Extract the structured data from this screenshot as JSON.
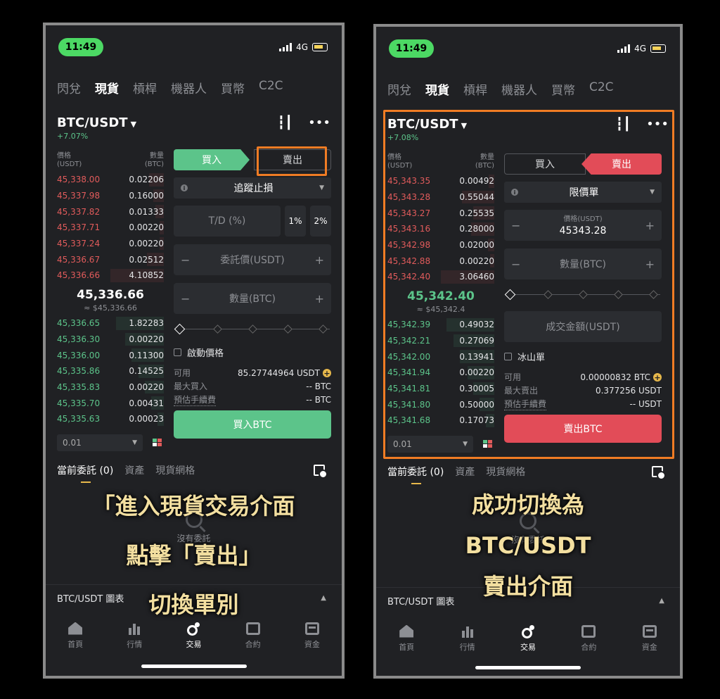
{
  "left": {
    "status": {
      "time": "11:49",
      "network": "4G"
    },
    "top_tabs": [
      "閃兌",
      "現貨",
      "槓桿",
      "機器人",
      "買幣",
      "C2C"
    ],
    "pair": {
      "name": "BTC/USDT",
      "change": "+7.07%"
    },
    "book": {
      "price_header": "價格",
      "price_unit": "(USDT)",
      "qty_header": "數量",
      "qty_unit": "(BTC)",
      "asks": [
        {
          "price": "45,338.00",
          "qty": "0.02206",
          "depth": 0.14
        },
        {
          "price": "45,337.98",
          "qty": "0.16000",
          "depth": 0.1
        },
        {
          "price": "45,337.82",
          "qty": "0.01333",
          "depth": 0.08
        },
        {
          "price": "45,337.71",
          "qty": "0.00220",
          "depth": 0.04
        },
        {
          "price": "45,337.24",
          "qty": "0.00220",
          "depth": 0.04
        },
        {
          "price": "45,336.67",
          "qty": "0.02512",
          "depth": 0.16
        },
        {
          "price": "45,336.66",
          "qty": "4.10852",
          "depth": 0.5
        }
      ],
      "mid_price": "45,336.66",
      "mid_sub": "≈ $45,336.66",
      "bids": [
        {
          "price": "45,336.65",
          "qty": "1.82283",
          "depth": 0.45
        },
        {
          "price": "45,336.30",
          "qty": "0.00220",
          "depth": 0.36
        },
        {
          "price": "45,336.00",
          "qty": "0.11300",
          "depth": 0.3
        },
        {
          "price": "45,335.86",
          "qty": "0.14525",
          "depth": 0.24
        },
        {
          "price": "45,335.83",
          "qty": "0.00220",
          "depth": 0.18
        },
        {
          "price": "45,335.70",
          "qty": "0.00431",
          "depth": 0.12
        },
        {
          "price": "45,335.63",
          "qty": "0.00023",
          "depth": 0.06
        }
      ],
      "depth_value": "0.01"
    },
    "form": {
      "buy_label": "買入",
      "sell_label": "賣出",
      "order_type": "追蹤止損",
      "td_placeholder": "T/D (%)",
      "pct1": "1%",
      "pct2": "2%",
      "price_placeholder": "委託價(USDT)",
      "amount_placeholder": "數量(BTC)",
      "check_label": "啟動價格",
      "available_label": "可用",
      "available_value": "85.27744964 USDT",
      "max_label": "最大買入",
      "max_value": "-- BTC",
      "fee_label": "預估手續費",
      "fee_value": "-- BTC",
      "submit_label": "買入BTC"
    },
    "bottom_tabs": [
      "當前委託 (0)",
      "資產",
      "現貨網格"
    ],
    "empty_text": "沒有委託",
    "chart_label": "BTC/USDT 圖表",
    "nav": [
      "首頁",
      "行情",
      "交易",
      "合約",
      "資金"
    ],
    "caption": [
      "「進入現貨交易介面",
      "點擊「賣出」",
      "切換單別"
    ]
  },
  "right": {
    "status": {
      "time": "11:49",
      "network": "4G"
    },
    "top_tabs": [
      "閃兌",
      "現貨",
      "槓桿",
      "機器人",
      "買幣",
      "C2C"
    ],
    "pair": {
      "name": "BTC/USDT",
      "change": "+7.08%"
    },
    "book": {
      "price_header": "價格",
      "price_unit": "(USDT)",
      "qty_header": "數量",
      "qty_unit": "(BTC)",
      "asks": [
        {
          "price": "45,343.35",
          "qty": "0.00492",
          "depth": 0.05
        },
        {
          "price": "45,343.28",
          "qty": "0.55044",
          "depth": 0.3
        },
        {
          "price": "45,343.27",
          "qty": "0.25535",
          "depth": 0.2
        },
        {
          "price": "45,343.16",
          "qty": "0.28000",
          "depth": 0.22
        },
        {
          "price": "45,342.98",
          "qty": "0.02000",
          "depth": 0.06
        },
        {
          "price": "45,342.88",
          "qty": "0.00220",
          "depth": 0.04
        },
        {
          "price": "45,342.40",
          "qty": "3.06460",
          "depth": 0.5
        }
      ],
      "mid_price": "45,342.40",
      "mid_sub": "≈ $45,342.4",
      "bids": [
        {
          "price": "45,342.39",
          "qty": "0.49032",
          "depth": 0.45
        },
        {
          "price": "45,342.21",
          "qty": "0.27069",
          "depth": 0.38
        },
        {
          "price": "45,342.00",
          "qty": "0.13941",
          "depth": 0.32
        },
        {
          "price": "45,341.94",
          "qty": "0.00220",
          "depth": 0.25
        },
        {
          "price": "45,341.81",
          "qty": "0.30005",
          "depth": 0.2
        },
        {
          "price": "45,341.80",
          "qty": "0.50000",
          "depth": 0.14
        },
        {
          "price": "45,341.68",
          "qty": "0.17073",
          "depth": 0.08
        }
      ],
      "depth_value": "0.01"
    },
    "form": {
      "buy_label": "買入",
      "sell_label": "賣出",
      "order_type": "限價單",
      "price_label": "價格(USDT)",
      "price_value": "45343.28",
      "amount_placeholder": "數量(BTC)",
      "total_placeholder": "成交金額(USDT)",
      "check_label": "冰山單",
      "available_label": "可用",
      "available_value": "0.00000832 BTC",
      "max_label": "最大賣出",
      "max_value": "0.377256 USDT",
      "fee_label": "預估手續費",
      "fee_value": "-- USDT",
      "submit_label": "賣出BTC"
    },
    "bottom_tabs": [
      "當前委託 (0)",
      "資產",
      "現貨網格"
    ],
    "empty_text": "沒有委託",
    "chart_label": "BTC/USDT 圖表",
    "nav": [
      "首頁",
      "行情",
      "交易",
      "合約",
      "資金"
    ],
    "caption": [
      "成功切換為",
      "BTC/USDT",
      "賣出介面"
    ]
  },
  "colors": {
    "ask": "#e15b5b",
    "bid": "#5cc48a",
    "buy_button": "#5cc48a",
    "sell_button": "#e24c58",
    "highlight": "#f07c24",
    "caption": "#f3dfa0"
  }
}
